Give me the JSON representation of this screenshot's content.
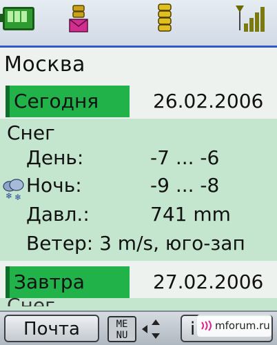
{
  "city": "Москва",
  "today": {
    "label": "Сегодня",
    "date": "26.02.2006",
    "condition": "Снег",
    "day_label": "День:",
    "day_value": "-7 ... -6",
    "night_label": "Ночь:",
    "night_value": "-9 ... -8",
    "pressure_label": "Давл.:",
    "pressure_value": "741 mm",
    "wind": "Ветер: 3 m/s, юго-зап"
  },
  "tomorrow": {
    "label": "Завтра",
    "date": "27.02.2006",
    "condition": "Снег"
  },
  "softkeys": {
    "left": "Почта",
    "menu_top": "ME",
    "menu_bottom": "NU",
    "right": "i"
  },
  "watermark": "mforum.ru",
  "colors": {
    "accent": "#22b24a",
    "panel": "#c4e6cf",
    "statusbar_border": "#2f57c8"
  },
  "icons": [
    "battery-icon",
    "message-icon",
    "coin-stack-icon",
    "signal-icon",
    "snow-cloud-icon",
    "nav-arrows-icon"
  ]
}
